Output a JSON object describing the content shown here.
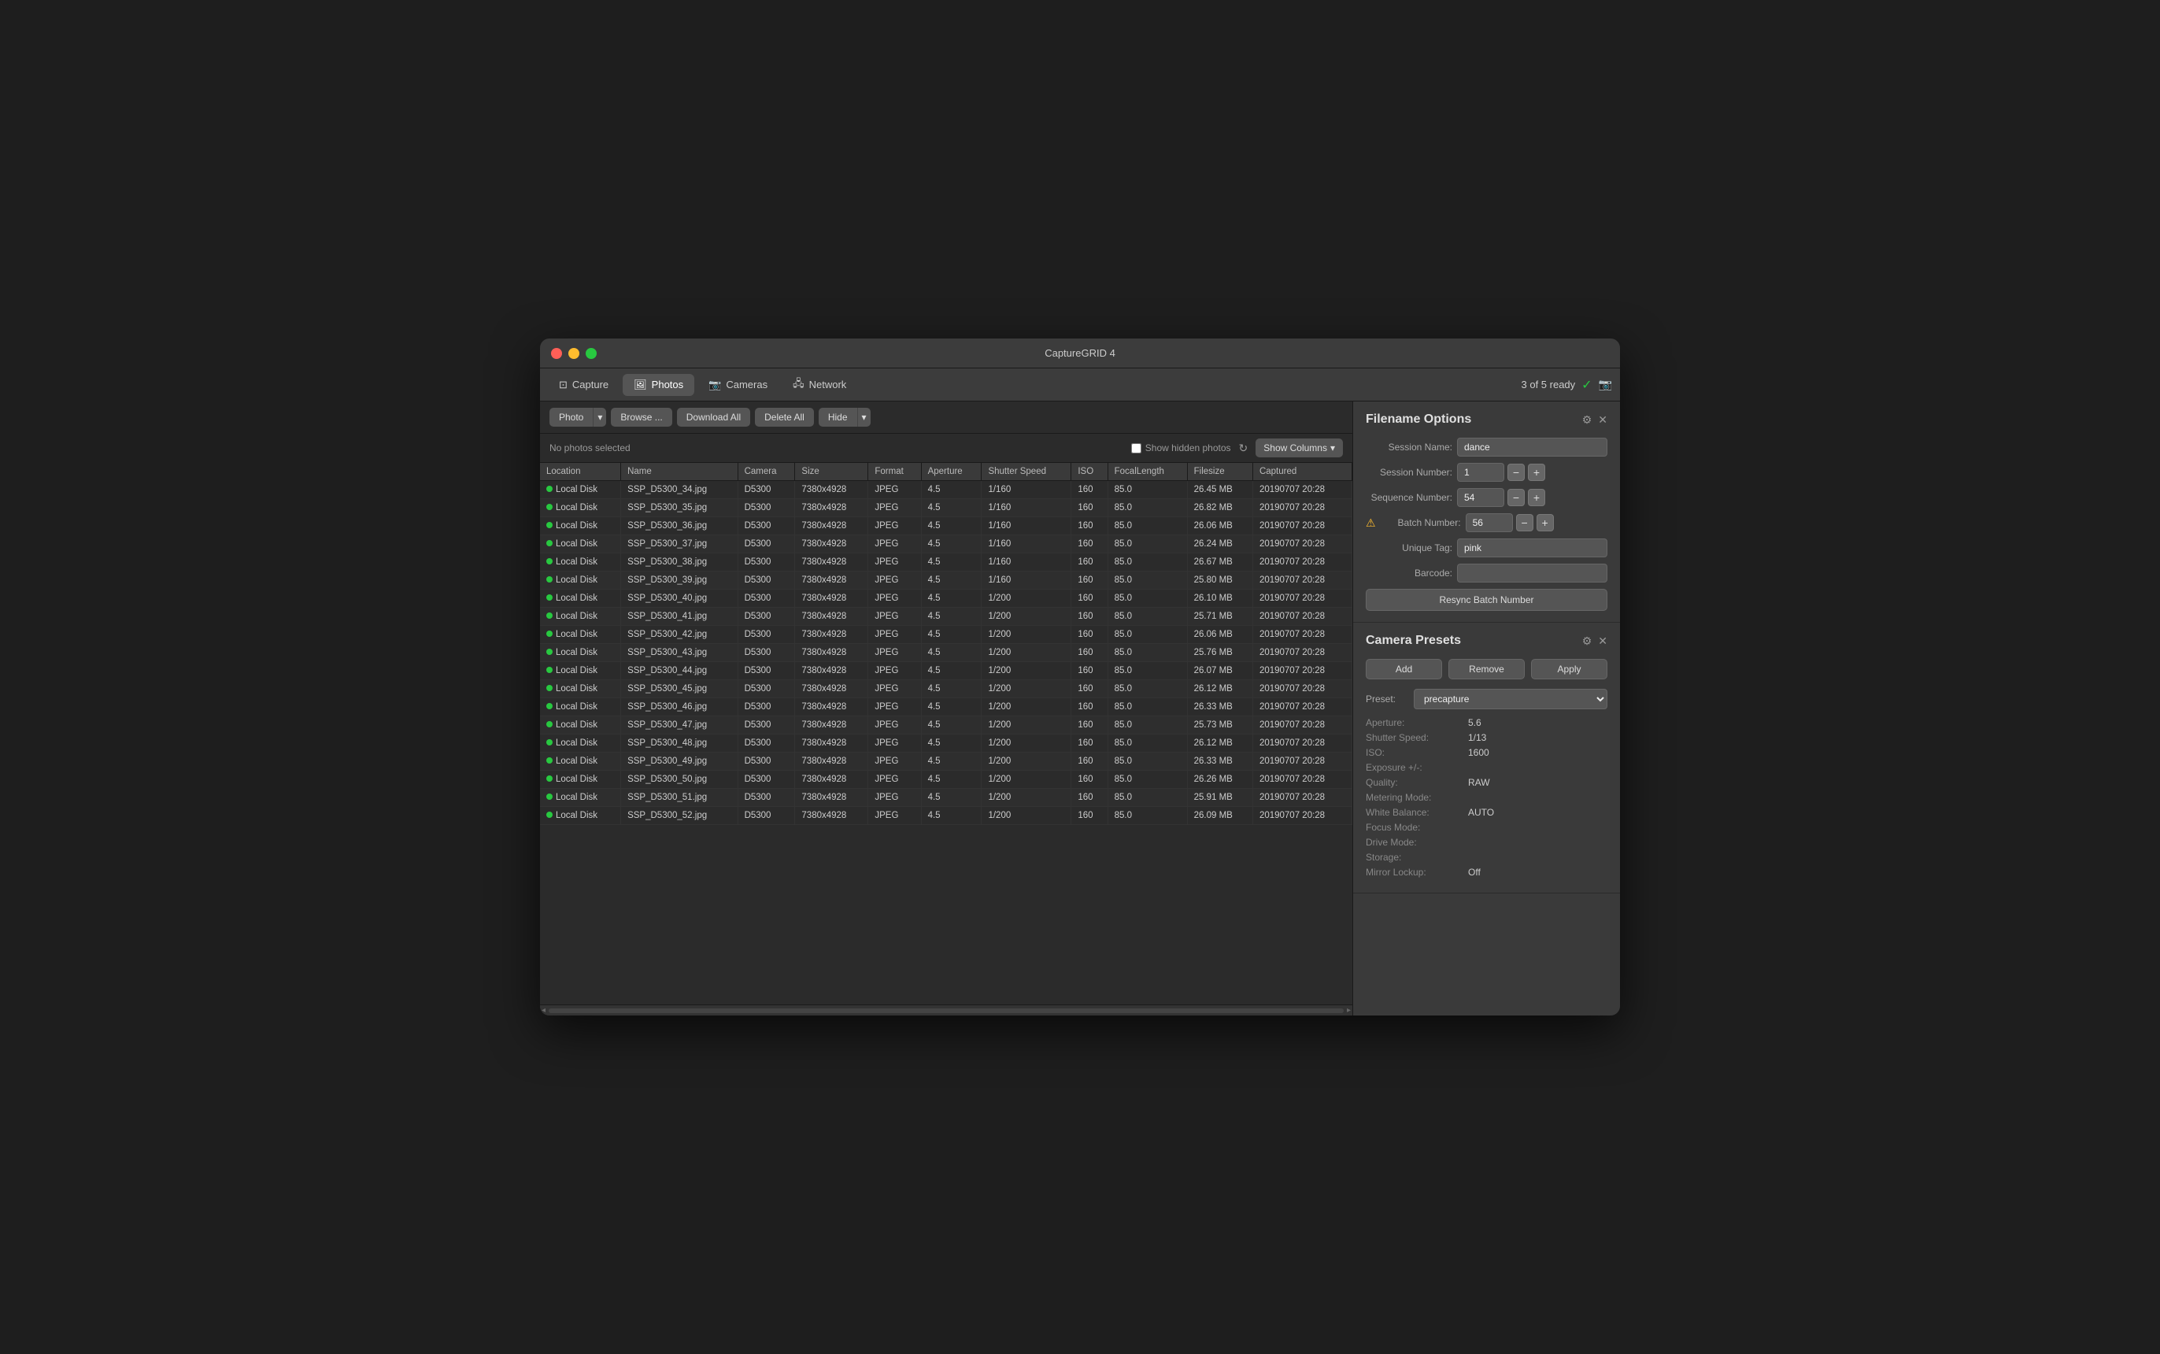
{
  "window": {
    "title": "CaptureGRID 4"
  },
  "tabs": [
    {
      "id": "capture",
      "label": "Capture",
      "icon": "⊡",
      "active": false
    },
    {
      "id": "photos",
      "label": "Photos",
      "icon": "🖼",
      "active": true
    },
    {
      "id": "cameras",
      "label": "Cameras",
      "icon": "📷",
      "active": false
    },
    {
      "id": "network",
      "label": "Network",
      "icon": "🖧",
      "active": false
    }
  ],
  "statusbar": {
    "ready_text": "3 of 5 ready",
    "check": "✓",
    "camera_icon": "📷"
  },
  "toolbar": {
    "photo_btn": "Photo",
    "browse_btn": "Browse ...",
    "download_all_btn": "Download All",
    "delete_all_btn": "Delete All",
    "hide_btn": "Hide"
  },
  "filterbar": {
    "no_photos_text": "No photos selected",
    "show_hidden_label": "Show hidden photos",
    "show_columns_btn": "Show Columns"
  },
  "table": {
    "columns": [
      "Location",
      "Name",
      "Camera",
      "Size",
      "Format",
      "Aperture",
      "Shutter Speed",
      "ISO",
      "FocalLength",
      "Filesize",
      "Captured"
    ],
    "rows": [
      [
        "Local Disk",
        "SSP_D5300_34.jpg",
        "D5300",
        "7380x4928",
        "JPEG",
        "4.5",
        "1/160",
        "160",
        "85.0",
        "26.45 MB",
        "20190707 20:28"
      ],
      [
        "Local Disk",
        "SSP_D5300_35.jpg",
        "D5300",
        "7380x4928",
        "JPEG",
        "4.5",
        "1/160",
        "160",
        "85.0",
        "26.82 MB",
        "20190707 20:28"
      ],
      [
        "Local Disk",
        "SSP_D5300_36.jpg",
        "D5300",
        "7380x4928",
        "JPEG",
        "4.5",
        "1/160",
        "160",
        "85.0",
        "26.06 MB",
        "20190707 20:28"
      ],
      [
        "Local Disk",
        "SSP_D5300_37.jpg",
        "D5300",
        "7380x4928",
        "JPEG",
        "4.5",
        "1/160",
        "160",
        "85.0",
        "26.24 MB",
        "20190707 20:28"
      ],
      [
        "Local Disk",
        "SSP_D5300_38.jpg",
        "D5300",
        "7380x4928",
        "JPEG",
        "4.5",
        "1/160",
        "160",
        "85.0",
        "26.67 MB",
        "20190707 20:28"
      ],
      [
        "Local Disk",
        "SSP_D5300_39.jpg",
        "D5300",
        "7380x4928",
        "JPEG",
        "4.5",
        "1/160",
        "160",
        "85.0",
        "25.80 MB",
        "20190707 20:28"
      ],
      [
        "Local Disk",
        "SSP_D5300_40.jpg",
        "D5300",
        "7380x4928",
        "JPEG",
        "4.5",
        "1/200",
        "160",
        "85.0",
        "26.10 MB",
        "20190707 20:28"
      ],
      [
        "Local Disk",
        "SSP_D5300_41.jpg",
        "D5300",
        "7380x4928",
        "JPEG",
        "4.5",
        "1/200",
        "160",
        "85.0",
        "25.71 MB",
        "20190707 20:28"
      ],
      [
        "Local Disk",
        "SSP_D5300_42.jpg",
        "D5300",
        "7380x4928",
        "JPEG",
        "4.5",
        "1/200",
        "160",
        "85.0",
        "26.06 MB",
        "20190707 20:28"
      ],
      [
        "Local Disk",
        "SSP_D5300_43.jpg",
        "D5300",
        "7380x4928",
        "JPEG",
        "4.5",
        "1/200",
        "160",
        "85.0",
        "25.76 MB",
        "20190707 20:28"
      ],
      [
        "Local Disk",
        "SSP_D5300_44.jpg",
        "D5300",
        "7380x4928",
        "JPEG",
        "4.5",
        "1/200",
        "160",
        "85.0",
        "26.07 MB",
        "20190707 20:28"
      ],
      [
        "Local Disk",
        "SSP_D5300_45.jpg",
        "D5300",
        "7380x4928",
        "JPEG",
        "4.5",
        "1/200",
        "160",
        "85.0",
        "26.12 MB",
        "20190707 20:28"
      ],
      [
        "Local Disk",
        "SSP_D5300_46.jpg",
        "D5300",
        "7380x4928",
        "JPEG",
        "4.5",
        "1/200",
        "160",
        "85.0",
        "26.33 MB",
        "20190707 20:28"
      ],
      [
        "Local Disk",
        "SSP_D5300_47.jpg",
        "D5300",
        "7380x4928",
        "JPEG",
        "4.5",
        "1/200",
        "160",
        "85.0",
        "25.73 MB",
        "20190707 20:28"
      ],
      [
        "Local Disk",
        "SSP_D5300_48.jpg",
        "D5300",
        "7380x4928",
        "JPEG",
        "4.5",
        "1/200",
        "160",
        "85.0",
        "26.12 MB",
        "20190707 20:28"
      ],
      [
        "Local Disk",
        "SSP_D5300_49.jpg",
        "D5300",
        "7380x4928",
        "JPEG",
        "4.5",
        "1/200",
        "160",
        "85.0",
        "26.33 MB",
        "20190707 20:28"
      ],
      [
        "Local Disk",
        "SSP_D5300_50.jpg",
        "D5300",
        "7380x4928",
        "JPEG",
        "4.5",
        "1/200",
        "160",
        "85.0",
        "26.26 MB",
        "20190707 20:28"
      ],
      [
        "Local Disk",
        "SSP_D5300_51.jpg",
        "D5300",
        "7380x4928",
        "JPEG",
        "4.5",
        "1/200",
        "160",
        "85.0",
        "25.91 MB",
        "20190707 20:28"
      ],
      [
        "Local Disk",
        "SSP_D5300_52.jpg",
        "D5300",
        "7380x4928",
        "JPEG",
        "4.5",
        "1/200",
        "160",
        "85.0",
        "26.09 MB",
        "20190707 20:28"
      ]
    ]
  },
  "filename_options": {
    "title": "Filename Options",
    "session_name_label": "Session Name:",
    "session_name_value": "dance",
    "session_number_label": "Session Number:",
    "session_number_value": "1",
    "sequence_number_label": "Sequence Number:",
    "sequence_number_value": "54",
    "batch_number_label": "Batch Number:",
    "batch_number_value": "56",
    "unique_tag_label": "Unique Tag:",
    "unique_tag_value": "pink",
    "barcode_label": "Barcode:",
    "barcode_value": "",
    "resync_btn": "Resync Batch Number"
  },
  "camera_presets": {
    "title": "Camera Presets",
    "add_btn": "Add",
    "remove_btn": "Remove",
    "apply_btn": "Apply",
    "preset_label": "Preset:",
    "preset_value": "precapture",
    "aperture_label": "Aperture:",
    "aperture_value": "5.6",
    "shutter_speed_label": "Shutter Speed:",
    "shutter_speed_value": "1/13",
    "iso_label": "ISO:",
    "iso_value": "1600",
    "exposure_label": "Exposure +/-:",
    "exposure_value": "",
    "quality_label": "Quality:",
    "quality_value": "RAW",
    "metering_mode_label": "Metering Mode:",
    "metering_mode_value": "",
    "white_balance_label": "White Balance:",
    "white_balance_value": "AUTO",
    "focus_mode_label": "Focus Mode:",
    "focus_mode_value": "",
    "drive_mode_label": "Drive Mode:",
    "drive_mode_value": "",
    "storage_label": "Storage:",
    "storage_value": "",
    "mirror_lockup_label": "Mirror Lockup:",
    "mirror_lockup_value": "Off"
  }
}
